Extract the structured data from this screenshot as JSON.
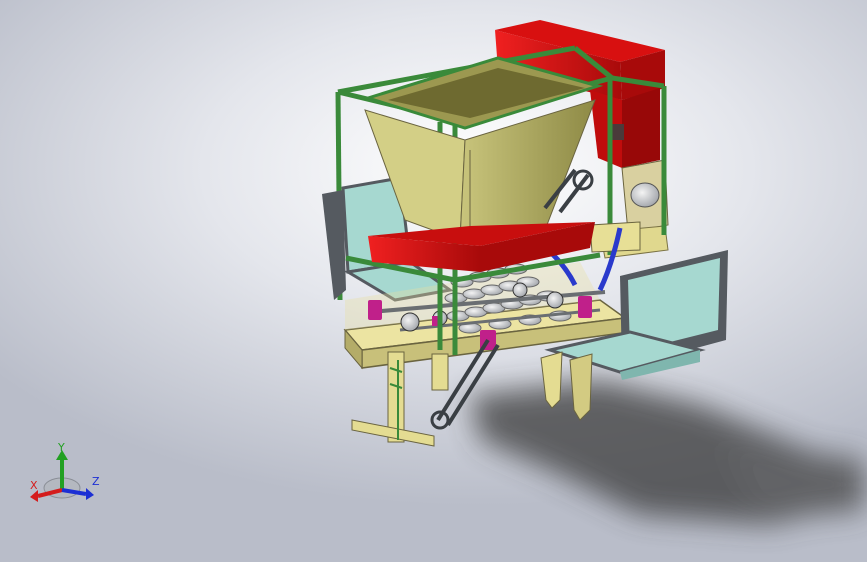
{
  "viewport": {
    "background_top": "#ffffff",
    "background_bottom": "#b9bdc9"
  },
  "model": {
    "frame_color": "#3a8a3a",
    "hopper_color": "#b8b46a",
    "hopper_dark": "#8e8a46",
    "tank_color": "#e01212",
    "tank_dark": "#a80a0a",
    "base_color": "#e9e2a0",
    "seat_color": "#a6d8d0",
    "seat_frame": "#555a60",
    "chain_color": "#3a3f44",
    "bearing_color": "#c0208a",
    "hose_color": "#2a3acc",
    "shadow_color": "#3a3a3a"
  },
  "triad": {
    "x_label": "X",
    "y_label": "Y",
    "z_label": "Z",
    "x_color": "#d41c1c",
    "y_color": "#22a022",
    "z_color": "#1c2fd4"
  }
}
